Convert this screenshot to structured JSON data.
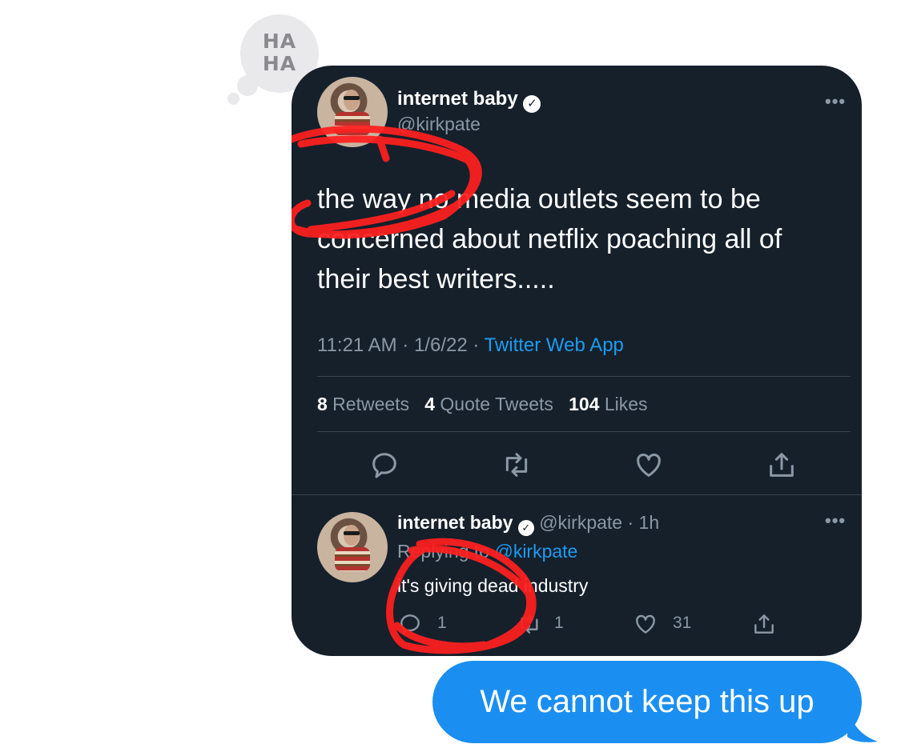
{
  "tapback": {
    "line1": "HA",
    "line2": "HA"
  },
  "main_tweet": {
    "display_name": "internet baby",
    "handle": "@kirkpate",
    "text_line1": "the way no media outlets seem to be",
    "text_line2": "concerned about netflix poaching all of",
    "text_line3": "their best writers.....",
    "time": "11:21 AM · 1/6/22 · ",
    "source": "Twitter Web App",
    "retweets_count": "8",
    "retweets_label": " Retweets",
    "quotes_count": "4",
    "quotes_label": " Quote Tweets",
    "likes_count": "104",
    "likes_label": " Likes",
    "more": "•••"
  },
  "reply_tweet": {
    "display_name": "internet baby",
    "handle_time": "@kirkpate · 1h",
    "replying_prefix": "Replying to ",
    "replying_handle": "@kirkpate",
    "text": "it's giving dead industry",
    "reply_count": "1",
    "retweet_count": "1",
    "like_count": "31",
    "more": "•••"
  },
  "sent_message": {
    "text": "We cannot keep this up"
  },
  "colors": {
    "card_bg": "#15202b",
    "link_blue": "#1d9bf0",
    "imessage_blue": "#1b8ef2",
    "scribble_red": "#ff1f1f"
  },
  "icons": [
    "reply-icon",
    "retweet-icon",
    "like-icon",
    "share-icon",
    "verified-badge-icon",
    "more-icon"
  ]
}
